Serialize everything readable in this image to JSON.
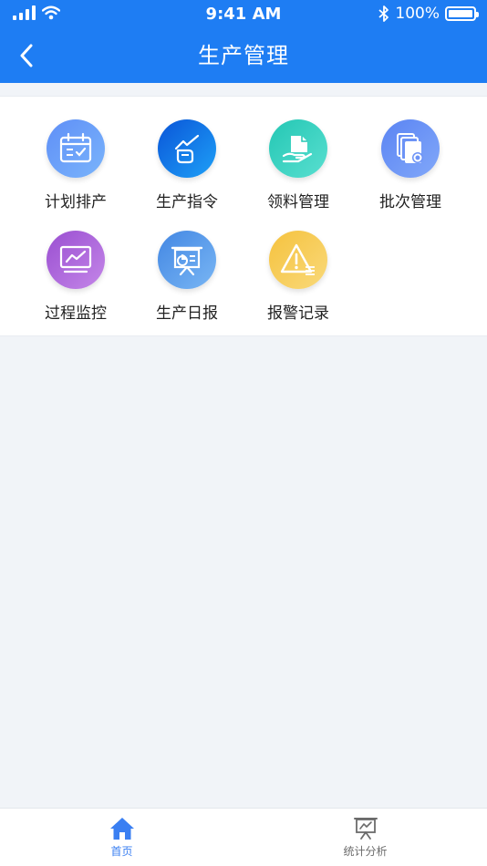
{
  "status_bar": {
    "time": "9:41 AM",
    "battery": "100%",
    "battery_level": 1.0
  },
  "header": {
    "title": "生产管理"
  },
  "menu": [
    {
      "label": "计划排产",
      "icon": "calendar-check-icon",
      "color_from": "#5f8ff7",
      "color_to": "#7ab4fb"
    },
    {
      "label": "生产指令",
      "icon": "hand-pointer-icon",
      "color_from": "#0a55d8",
      "color_to": "#1ea0f7"
    },
    {
      "label": "领料管理",
      "icon": "hand-document-icon",
      "color_from": "#24c7b4",
      "color_to": "#59dfd0"
    },
    {
      "label": "批次管理",
      "icon": "files-gear-icon",
      "color_from": "#5a84f3",
      "color_to": "#82a8f9"
    },
    {
      "label": "过程监控",
      "icon": "monitor-chart-icon",
      "color_from": "#9a4fd1",
      "color_to": "#c486e8"
    },
    {
      "label": "生产日报",
      "icon": "presentation-board-icon",
      "color_from": "#4387e3",
      "color_to": "#79b6f4"
    },
    {
      "label": "报警记录",
      "icon": "warning-triangle-icon",
      "color_from": "#f5c23e",
      "color_to": "#f9d97a"
    }
  ],
  "tabbar": [
    {
      "label": "首页",
      "icon": "home-icon",
      "active": true
    },
    {
      "label": "统计分析",
      "icon": "chart-board-icon",
      "active": false
    }
  ],
  "colors": {
    "primary": "#1e7df3",
    "tab_active": "#3a7ff2",
    "page_bg": "#f1f4f8"
  }
}
